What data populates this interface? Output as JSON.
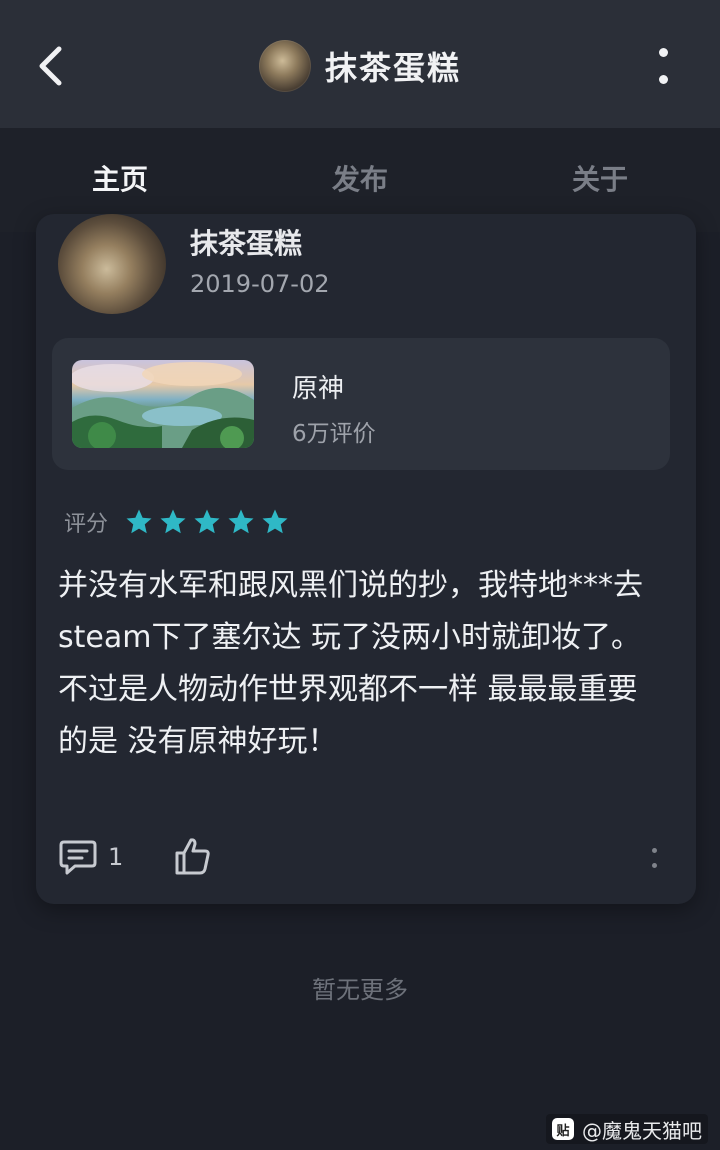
{
  "header": {
    "title": "抹茶蛋糕"
  },
  "tabs": [
    {
      "label": "主页",
      "active": true
    },
    {
      "label": "发布",
      "active": false
    },
    {
      "label": "关于",
      "active": false
    }
  ],
  "post": {
    "author": "抹茶蛋糕",
    "date": "2019-07-02",
    "game": {
      "name": "原神",
      "reviews": "6万评价"
    },
    "rating_label": "评分",
    "rating_stars": 5,
    "rating_max": 5,
    "text": "并没有水军和跟风黑们说的抄，我特地***去steam下了塞尔达 玩了没两小时就卸妆了。不过是人物动作世界观都不一样 最最最重要的是 没有原神好玩！",
    "comment_count": "1"
  },
  "footer": {
    "no_more": "暂无更多"
  },
  "watermark": {
    "text": "@魔鬼天猫吧",
    "logo": "贴"
  },
  "colors": {
    "accent": "#35a7b3",
    "star": "#2fb8c6",
    "background": "#1c1f28",
    "card": "#232731"
  }
}
